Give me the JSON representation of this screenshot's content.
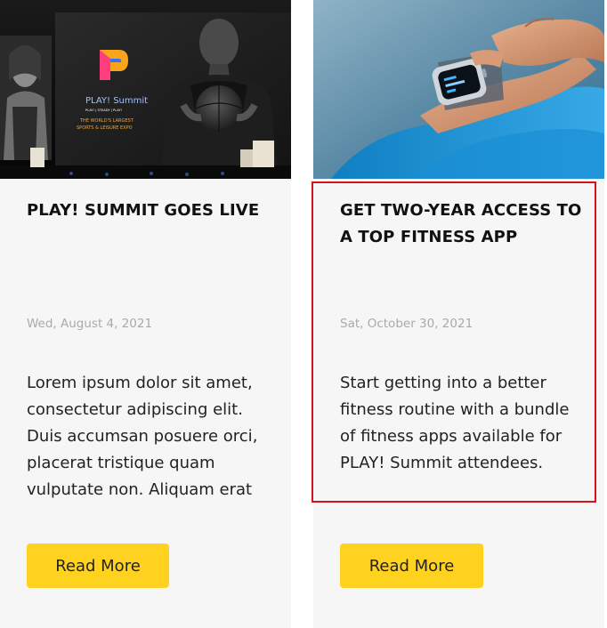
{
  "cards": [
    {
      "image": "summit-stage-photo",
      "title": "PLAY! SUMMIT GOES LIVE",
      "date": "Wed, August 4, 2021",
      "excerpt": "Lorem ipsum dolor sit amet, consectetur adipiscing elit. Duis accumsan posuere orci, placerat tristique quam vulputate non. Aliquam erat",
      "button_label": "Read More",
      "screen_text": {
        "brand": "PLAY! Summit",
        "nav": "PLAY! | STEADY | PLAY!",
        "tagline_1": "THE WORLD'S LARGEST",
        "tagline_2": "SPORTS & LEISURE EXPO"
      }
    },
    {
      "image": "smartwatch-wrist-photo",
      "title": "GET TWO-YEAR ACCESS TO A TOP FITNESS APP",
      "date": "Sat, October 30, 2021",
      "excerpt": "Start getting into a better fitness routine with a bundle of fitness apps available for PLAY! Summit attendees.",
      "button_label": "Read More"
    }
  ],
  "colors": {
    "card_background": "#f6f6f6",
    "button_background": "#fed21f",
    "highlight_border": "#d8121b",
    "date_text": "#aaaaaa"
  }
}
